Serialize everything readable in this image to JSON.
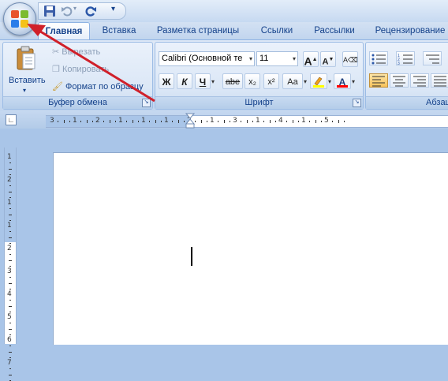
{
  "tabs": [
    {
      "label": "Главная",
      "active": true
    },
    {
      "label": "Вставка"
    },
    {
      "label": "Разметка страницы"
    },
    {
      "label": "Ссылки"
    },
    {
      "label": "Рассылки"
    },
    {
      "label": "Рецензирование"
    }
  ],
  "clipboard": {
    "paste_label": "Вставить",
    "cut_label": "Вырезать",
    "copy_label": "Копировать",
    "format_painter_label": "Формат по образцу",
    "group_label": "Буфер обмена"
  },
  "font": {
    "font_name": "Calibri (Основной те",
    "font_size": "11",
    "group_label": "Шрифт",
    "bold": "Ж",
    "italic": "К",
    "underline": "Ч",
    "strike": "abe",
    "subscript": "x₂",
    "superscript": "x²",
    "change_case": "Aa",
    "grow": "A",
    "shrink": "A",
    "text_color": "A"
  },
  "paragraph": {
    "group_label": "Абзац"
  },
  "rulers": {
    "horizontal_numbers": [
      "3",
      "1",
      "2",
      "1",
      "1",
      "1",
      "2",
      "1",
      "3",
      "1",
      "4",
      "1",
      "5"
    ],
    "vertical_numbers": [
      "1",
      "2",
      "1",
      "1",
      "2",
      "3",
      "4",
      "5",
      "6",
      "7"
    ]
  },
  "colors": {
    "ribbon_blue": "#dfe9f6",
    "accent_text": "#15428b",
    "highlight_yellow": "#ffff00",
    "font_color_red": "#ff0000",
    "arrow_red": "#d0202a"
  }
}
